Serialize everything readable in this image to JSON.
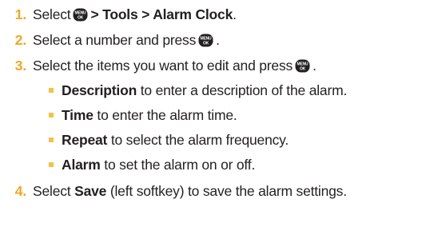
{
  "steps": [
    {
      "number": "1.",
      "text_a": "Select",
      "icon": "menu-ok-key-icon",
      "text_b": "> Tools > Alarm Clock",
      "text_c": "."
    },
    {
      "number": "2.",
      "text_a": "Select a number and press",
      "icon": "menu-ok-key-icon",
      "text_c": "."
    },
    {
      "number": "3.",
      "text_a": "Select the items you want to edit and press",
      "icon": "menu-ok-key-icon",
      "text_c": "."
    },
    {
      "number": "4.",
      "bold": "Save",
      "text": "(left softkey) to save the alarm settings."
    }
  ],
  "subitems": [
    {
      "bold": "Description",
      "text": "to enter a description of the alarm."
    },
    {
      "bold": "Time",
      "text": "to enter the alarm time."
    },
    {
      "bold": "Repeat",
      "text": "to select the alarm frequency."
    },
    {
      "bold": "Alarm",
      "text": "to set the alarm on or off."
    }
  ],
  "key_icon": {
    "top_text": "MENU",
    "bottom_text": "OK"
  },
  "colors": {
    "number": "#f5a623",
    "bullet": "#f5c242",
    "text": "#231f20",
    "key": "#231f20"
  }
}
